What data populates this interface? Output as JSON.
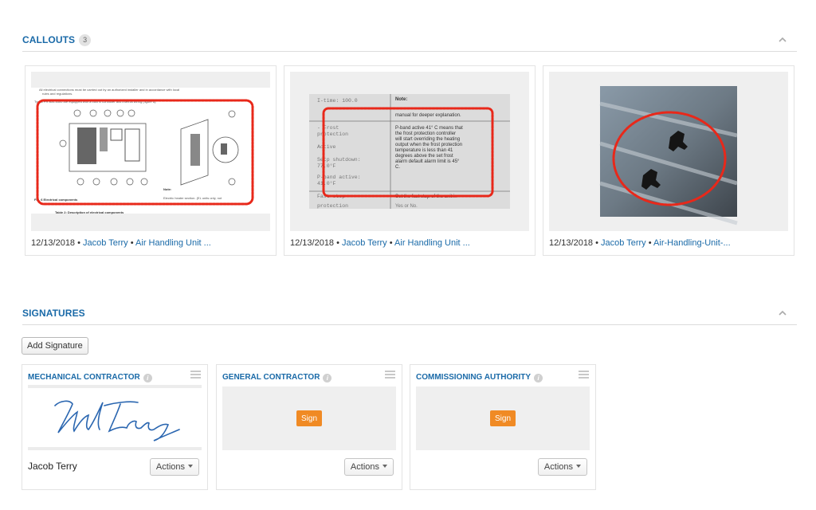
{
  "callouts": {
    "title": "CALLOUTS",
    "count": "3",
    "items": [
      {
        "date": "12/13/2018",
        "sep1": " • ",
        "author": "Jacob Terry",
        "sep2": " • ",
        "ref": "Air Handling Unit ..."
      },
      {
        "date": "12/13/2018",
        "sep1": " • ",
        "author": "Jacob Terry",
        "sep2": " • ",
        "ref": "Air Handling Unit ..."
      },
      {
        "date": "12/13/2018",
        "sep1": " • ",
        "author": "Jacob Terry",
        "sep2": " • ",
        "ref": "Air-Handling-Unit-..."
      }
    ],
    "thumb2_text": {
      "itime": "I-time:  100.0",
      "note": "Note:",
      "manual": "manual for deeper explanation.",
      "frost1": "- Frost",
      "frost2": "protection",
      "active": "Active",
      "setp1": "Setp shutdown:",
      "setp2": "77.0°F",
      "pband1": "P-band active:",
      "pband2": "41.0°F",
      "desc1": "P-band active 41° C means that",
      "desc2": "the frost protection controller",
      "desc3": "will start overriding the heating",
      "desc4": "output when the frost protection",
      "desc5": "temperature is less than 41",
      "desc6": "degrees above the set frost",
      "desc7": "alarm default alarm limit is 45°",
      "desc8": "C.",
      "faststop": "Fast stop",
      "setfast": "Set the fast stop of the unit in",
      "protection": "protection",
      "yesno": "Yes or No."
    },
    "thumb1_text": {
      "line1": "All electrical connections must be carried out by an authorized installer and in accordance with local",
      "line2": "rules and regulations.",
      "line3": "Types PR 800-3400 are equipped with a built in controller and internal wiring (figure 6).",
      "note": "Note:",
      "elec": "Electric heater section. (EL units only, not",
      "fig": "Fig. 6 Electrical components",
      "table": "Table 2: Description of electrical components"
    }
  },
  "signatures": {
    "title": "SIGNATURES",
    "add_label": "Add Signature",
    "sign_label": "Sign",
    "actions_label": "Actions",
    "cards": [
      {
        "title": "MECHANICAL CONTRACTOR",
        "signer": "Jacob Terry"
      },
      {
        "title": "GENERAL CONTRACTOR",
        "signer": ""
      },
      {
        "title": "COMMISSIONING AUTHORITY",
        "signer": ""
      }
    ]
  },
  "colors": {
    "accent": "#1a6aa8",
    "sign_button": "#f08a24",
    "callout_stroke": "#e8281a"
  },
  "icons": {
    "collapse": "chevron-up-icon",
    "info": "info-icon",
    "menu": "hamburger-menu-icon",
    "caret": "caret-down-icon"
  }
}
